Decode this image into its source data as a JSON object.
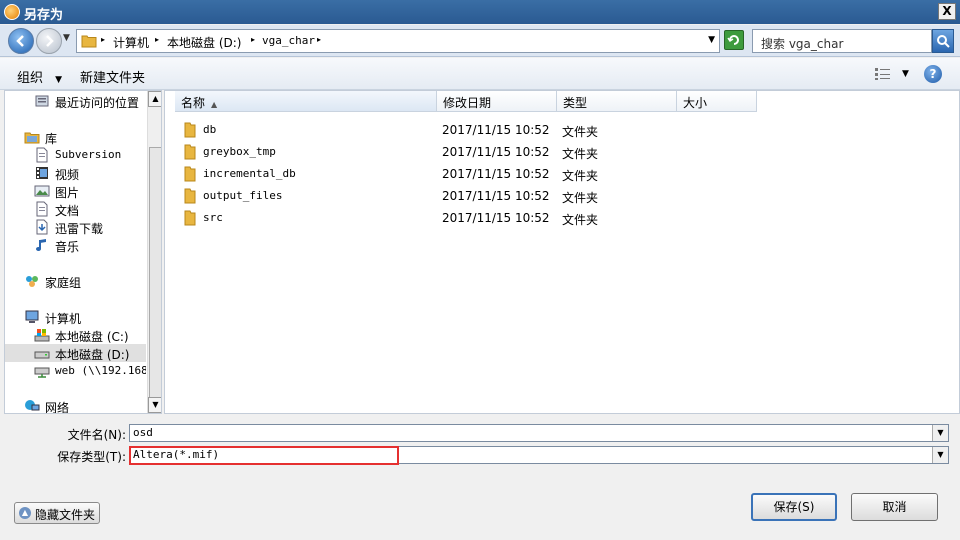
{
  "window": {
    "title": "另存为",
    "close_label": "X"
  },
  "address": {
    "crumbs": [
      "计算机",
      "本地磁盘 (D:)",
      "vga_char"
    ],
    "search_placeholder": "搜索 vga_char"
  },
  "toolbar": {
    "organize_label": "组织",
    "new_folder_label": "新建文件夹",
    "help_label": "?"
  },
  "nav": {
    "items": [
      {
        "label": "最近访问的位置",
        "icon": "recent-places-icon"
      },
      {
        "label": "库",
        "icon": "library-icon"
      },
      {
        "label": "Subversion",
        "icon": "document-icon"
      },
      {
        "label": "视频",
        "icon": "video-icon"
      },
      {
        "label": "图片",
        "icon": "picture-icon"
      },
      {
        "label": "文档",
        "icon": "document-icon"
      },
      {
        "label": "迅雷下载",
        "icon": "download-icon"
      },
      {
        "label": "音乐",
        "icon": "music-icon"
      },
      {
        "label": "家庭组",
        "icon": "homegroup-icon"
      },
      {
        "label": "计算机",
        "icon": "computer-icon"
      },
      {
        "label": "本地磁盘 (C:)",
        "icon": "drive-icon"
      },
      {
        "label": "本地磁盘 (D:)",
        "icon": "drive-icon"
      },
      {
        "label": "web (\\\\192.168.",
        "icon": "network-drive-icon"
      },
      {
        "label": "网络",
        "icon": "network-icon"
      }
    ]
  },
  "files": {
    "columns": [
      "名称",
      "修改日期",
      "类型",
      "大小"
    ],
    "rows": [
      {
        "name": "db",
        "date": "2017/11/15 10:52",
        "type": "文件夹"
      },
      {
        "name": "greybox_tmp",
        "date": "2017/11/15 10:52",
        "type": "文件夹"
      },
      {
        "name": "incremental_db",
        "date": "2017/11/15 10:52",
        "type": "文件夹"
      },
      {
        "name": "output_files",
        "date": "2017/11/15 10:52",
        "type": "文件夹"
      },
      {
        "name": "src",
        "date": "2017/11/15 10:52",
        "type": "文件夹"
      }
    ]
  },
  "form": {
    "filename_label": "文件名(N):",
    "filename_value": "osd",
    "filetype_label": "保存类型(T):",
    "filetype_value": "Altera(*.mif)"
  },
  "buttons": {
    "hide_folders": "隐藏文件夹",
    "save": "保存(S)",
    "cancel": "取消"
  },
  "colors": {
    "highlight": "#e53030",
    "titlebar": "#3a6ea5",
    "folder": "#e8b640"
  }
}
